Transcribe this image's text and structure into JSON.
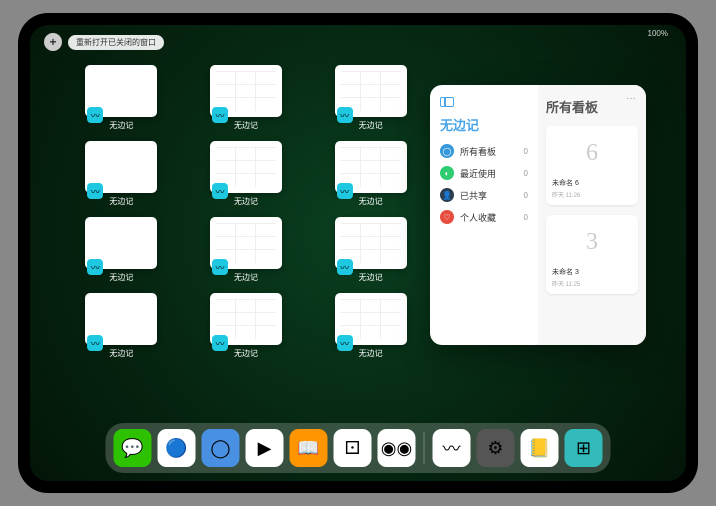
{
  "status": "100%",
  "reopen_label": "重新打开已关闭的窗口",
  "add_label": "+",
  "window_name": "无边记",
  "windows": [
    {
      "style": "blank"
    },
    {
      "style": "grid"
    },
    {
      "style": "grid"
    },
    {
      "style": "blank"
    },
    {
      "style": "grid"
    },
    {
      "style": "grid"
    },
    {
      "style": "blank"
    },
    {
      "style": "grid"
    },
    {
      "style": "grid"
    },
    {
      "style": "blank"
    },
    {
      "style": "grid"
    },
    {
      "style": "grid"
    }
  ],
  "popover": {
    "app_title": "无边记",
    "right_title": "所有看板",
    "categories": [
      {
        "icon": "blue",
        "label": "所有看板",
        "count": 0,
        "glyph": "◯"
      },
      {
        "icon": "green",
        "label": "最近使用",
        "count": 0,
        "glyph": "◐"
      },
      {
        "icon": "navy",
        "label": "已共享",
        "count": 0,
        "glyph": "👤"
      },
      {
        "icon": "red",
        "label": "个人收藏",
        "count": 0,
        "glyph": "♡"
      }
    ],
    "boards": [
      {
        "glyph": "6",
        "title": "未命名 6",
        "sub": "昨天 11:26"
      },
      {
        "glyph": "3",
        "title": "未命名 3",
        "sub": "昨天 11:25"
      }
    ]
  },
  "dock": [
    {
      "name": "wechat",
      "bg": "#2dc100",
      "glyph": "💬"
    },
    {
      "name": "quark-hd",
      "bg": "#fff",
      "glyph": "🔵"
    },
    {
      "name": "quark",
      "bg": "#4a90e2",
      "glyph": "◯"
    },
    {
      "name": "play",
      "bg": "#fff",
      "glyph": "▶"
    },
    {
      "name": "books",
      "bg": "#ff9500",
      "glyph": "📖"
    },
    {
      "name": "dice",
      "bg": "#fff",
      "glyph": "⚀"
    },
    {
      "name": "connect",
      "bg": "#fff",
      "glyph": "◉◉"
    },
    {
      "name": "freeform",
      "bg": "#fff",
      "glyph": "〰"
    },
    {
      "name": "settings",
      "bg": "#555",
      "glyph": "⚙"
    },
    {
      "name": "notes",
      "bg": "#fff",
      "glyph": "📒"
    },
    {
      "name": "recent",
      "bg": "#3bb",
      "glyph": "⊞"
    }
  ]
}
